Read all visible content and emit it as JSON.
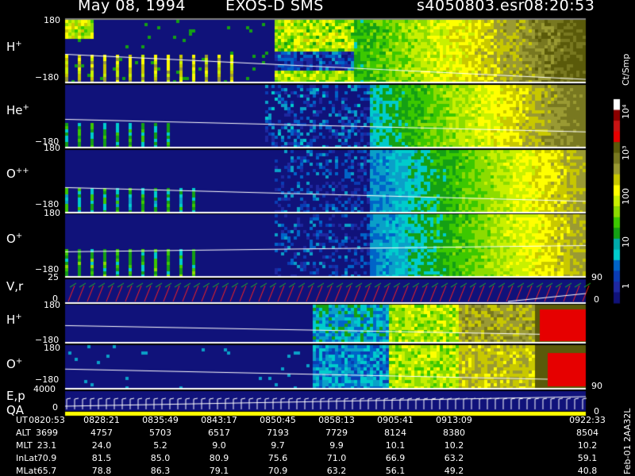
{
  "header": {
    "date": "May 08, 1994",
    "instrument": "EXOS-D SMS",
    "file": "s4050803.esr",
    "time": "08:20:53"
  },
  "panels": [
    {
      "label": "H",
      "sup": "+",
      "top_tick": "180",
      "bottom_tick": "−180"
    },
    {
      "label": "He",
      "sup": "+",
      "top_tick": "180",
      "bottom_tick": "−180"
    },
    {
      "label": "O",
      "sup": "++",
      "top_tick": "180",
      "bottom_tick": "−180"
    },
    {
      "label": "O",
      "sup": "+",
      "top_tick": "180",
      "bottom_tick": "−180"
    },
    {
      "label": "V,r",
      "sup": "",
      "top_tick": "25",
      "bottom_tick": "0",
      "right_top": "90",
      "right_bottom": "0"
    },
    {
      "label": "H",
      "sup": "+",
      "top_tick": "180",
      "bottom_tick": "−180"
    },
    {
      "label": "O",
      "sup": "+",
      "top_tick": "180",
      "bottom_tick": "−180",
      "right_bottom": "90"
    },
    {
      "label": "E,p",
      "sup": "",
      "top_tick": "4000",
      "bottom_tick": "0",
      "right_bottom": "0"
    }
  ],
  "qa_label": "QA",
  "colorbar": {
    "unit": "Ct/Smp",
    "ticks": [
      "10⁴",
      "10³",
      "100",
      "10",
      "1"
    ],
    "colors": [
      "#ffffff",
      "#8b0000",
      "#c81414",
      "#e60000",
      "#5a5a0a",
      "#787820",
      "#9a9a33",
      "#c8c800",
      "#ffff00",
      "#c8f000",
      "#8cdc00",
      "#3cc800",
      "#14a014",
      "#00aaaa",
      "#00cccc",
      "#0064c8",
      "#0a3cb4",
      "#1e28a0",
      "#10127a"
    ]
  },
  "side_text": "Feb-01 2AA32L",
  "table": {
    "row_labels": [
      "UT",
      "ALT",
      "MLT",
      "InLat",
      "MLat"
    ],
    "columns": [
      [
        "0820:53",
        "3699",
        "23.1",
        "70.9",
        "65.7"
      ],
      [
        "0828:21",
        "4757",
        "24.0",
        "81.5",
        "78.8"
      ],
      [
        "0835:49",
        "5703",
        "5.2",
        "85.0",
        "86.3"
      ],
      [
        "0843:17",
        "6517",
        "9.0",
        "80.9",
        "79.1"
      ],
      [
        "0850:45",
        "7193",
        "9.7",
        "75.6",
        "70.9"
      ],
      [
        "0858:13",
        "7729",
        "9.9",
        "71.0",
        "63.2"
      ],
      [
        "0905:41",
        "8124",
        "10.1",
        "66.9",
        "56.1"
      ],
      [
        "0913:09",
        "8380",
        "10.2",
        "63.2",
        "49.2"
      ],
      [
        "0922:33",
        "8504",
        "10.2",
        "59.1",
        "40.8"
      ]
    ]
  },
  "chart_data": {
    "type": "heatmap",
    "title": "May 08, 1994   EXOS-D SMS",
    "x_tick_labels": [
      "0820:53",
      "0828:21",
      "0835:49",
      "0843:17",
      "0850:45",
      "0858:13",
      "0905:41",
      "0913:09",
      "0922:33"
    ],
    "panels": [
      "H+",
      "He+",
      "O++",
      "O+",
      "V,r",
      "H+",
      "O+",
      "E,p"
    ],
    "y_range_pitch_angle": [
      -180,
      180
    ],
    "color_scale": "log",
    "color_range": [
      1,
      10000
    ],
    "colorbar_label": "Ct/Smp"
  }
}
